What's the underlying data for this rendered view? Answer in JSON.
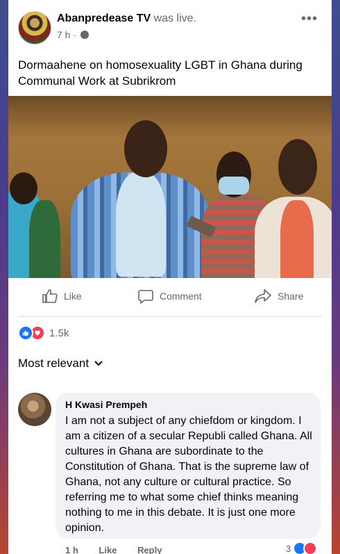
{
  "post": {
    "page_name": "Abanpredease TV",
    "status": "was live.",
    "time": "7 h",
    "audience_icon": "globe-icon",
    "text": "Dormaahene on homosexuality  LGBT in Ghana during Communal Work at Subrikrom"
  },
  "actions": {
    "like": "Like",
    "comment": "Comment",
    "share": "Share"
  },
  "reactions": {
    "count": "1.5k"
  },
  "comments": {
    "sort_label": "Most relevant",
    "items": [
      {
        "author": "H Kwasi Prempeh",
        "text": "I am not a subject of any chiefdom or kingdom. I am a citizen of a secular Republi called Ghana. All cultures in Ghana are subordinate to the Constitution of Ghana. That is the supreme law of Ghana, not any culture or cultural practice. So referring me to what some chief thinks meaning nothing to me in this debate. It is just one more opinion.",
        "time": "1 h",
        "like": "Like",
        "reply": "Reply",
        "reaction_count": "3"
      }
    ]
  }
}
